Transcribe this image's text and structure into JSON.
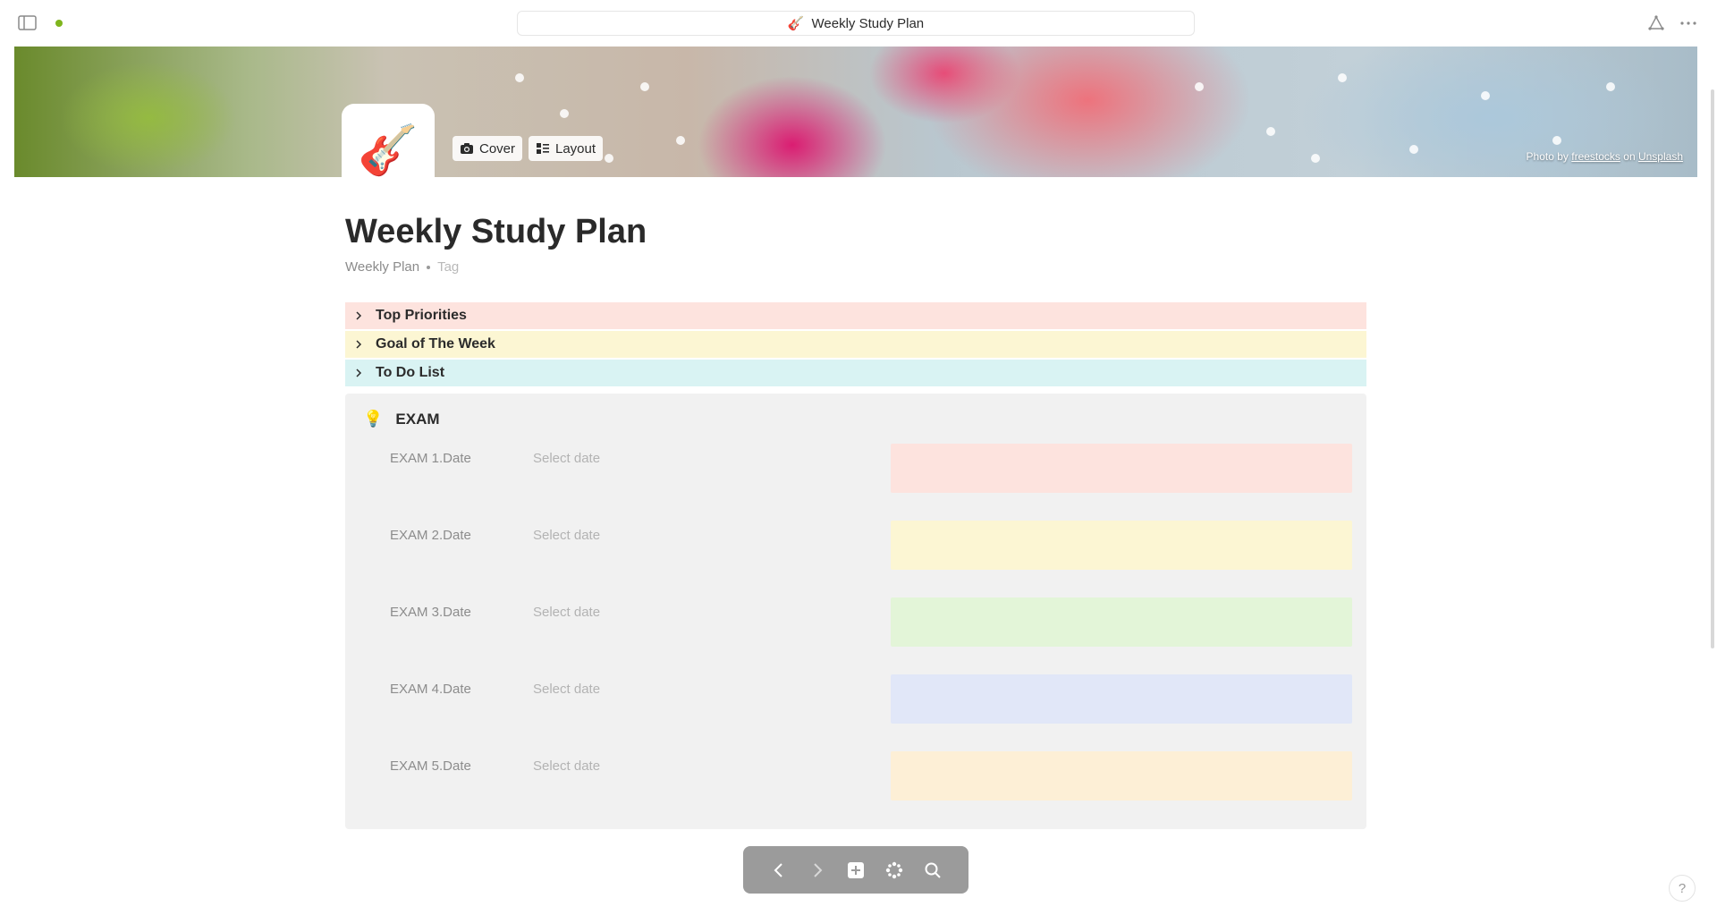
{
  "window": {
    "title_emoji": "🎸",
    "title": "Weekly Study Plan"
  },
  "cover": {
    "cover_button": "Cover",
    "layout_button": "Layout",
    "credit_prefix": "Photo by",
    "credit_author": "freestocks",
    "credit_on": "on",
    "credit_site": "Unsplash",
    "page_icon": "🎸"
  },
  "page": {
    "title": "Weekly Study Plan",
    "category": "Weekly Plan",
    "tag_placeholder": "Tag"
  },
  "toggles": [
    {
      "label": "Top Priorities",
      "color": "#fde3de"
    },
    {
      "label": "Goal of The Week",
      "color": "#fcf6d3"
    },
    {
      "label": "To Do List",
      "color": "#d9f3f3"
    }
  ],
  "exam": {
    "icon": "💡",
    "heading": "EXAM",
    "rows": [
      {
        "name": "EXAM 1.Date",
        "date": "Select date",
        "color": "#fde3de"
      },
      {
        "name": "EXAM 2.Date",
        "date": "Select date",
        "color": "#fcf6d3"
      },
      {
        "name": "EXAM 3.Date",
        "date": "Select date",
        "color": "#e3f5d8"
      },
      {
        "name": "EXAM 4.Date",
        "date": "Select date",
        "color": "#e1e7f8"
      },
      {
        "name": "EXAM 5.Date",
        "date": "Select date",
        "color": "#fdefd6"
      }
    ]
  },
  "help": {
    "label": "?"
  }
}
